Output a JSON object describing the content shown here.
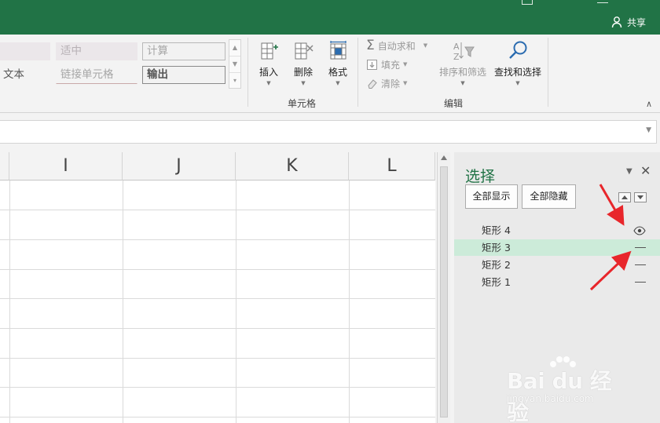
{
  "titlebar": {
    "share_label": "共享",
    "share_icon": "person-icon"
  },
  "ribbon": {
    "styles": {
      "neutral_label": "适中",
      "calc_label": "计算",
      "explain_label": "文本",
      "linked_cell_label": "链接单元格",
      "output_label": "输出"
    },
    "cells_group": {
      "label": "单元格",
      "insert_label": "插入",
      "delete_label": "删除",
      "format_label": "格式"
    },
    "editing_group": {
      "label": "编辑",
      "autosum_label": "自动求和",
      "fill_label": "填充",
      "clear_label": "清除",
      "sort_filter_label": "排序和筛选",
      "find_select_label": "查找和选择"
    }
  },
  "sheet": {
    "columns": [
      "I",
      "J",
      "K",
      "L"
    ]
  },
  "selection_pane": {
    "title": "选择",
    "show_all_label": "全部显示",
    "hide_all_label": "全部隐藏",
    "shapes": [
      {
        "name": "矩形 4",
        "visibility": "visible"
      },
      {
        "name": "矩形 3",
        "visibility": "hidden",
        "selected": true
      },
      {
        "name": "矩形 2",
        "visibility": "hidden"
      },
      {
        "name": "矩形 1",
        "visibility": "hidden"
      }
    ]
  },
  "watermark": {
    "brand": "Bai du 经验",
    "url": "jingyan.baidu.com"
  },
  "colors": {
    "accent": "#217346",
    "annotation": "#e8262b",
    "selected_row": "#ccebd9"
  }
}
